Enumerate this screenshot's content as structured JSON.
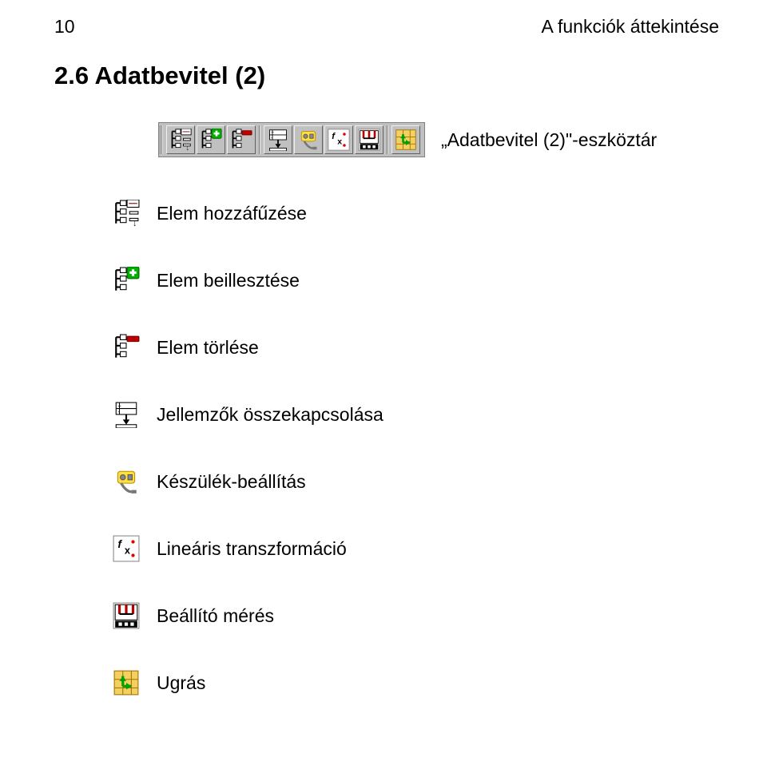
{
  "header": {
    "page_number": "10",
    "doc_title": "A funkciók áttekintése"
  },
  "section": {
    "heading": "2.6  Adatbevitel (2)"
  },
  "toolbar": {
    "caption": "„Adatbevitel (2)\"-eszköztár"
  },
  "icons": {
    "append": {
      "name": "tree-append-icon"
    },
    "insert": {
      "name": "tree-insert-icon"
    },
    "delete": {
      "name": "tree-delete-icon"
    },
    "link": {
      "name": "link-attributes-icon"
    },
    "device": {
      "name": "device-settings-icon"
    },
    "linear": {
      "name": "linear-transform-icon"
    },
    "measure": {
      "name": "tuning-measure-icon"
    },
    "jump": {
      "name": "jump-icon"
    }
  },
  "items": [
    {
      "key": "append",
      "label": "Elem hozzáfűzése"
    },
    {
      "key": "insert",
      "label": "Elem beillesztése"
    },
    {
      "key": "delete",
      "label": "Elem törlése"
    },
    {
      "key": "link",
      "label": "Jellemzők összekapcsolása"
    },
    {
      "key": "device",
      "label": "Készülék-beállítás"
    },
    {
      "key": "linear",
      "label": "Lineáris transzformáció"
    },
    {
      "key": "measure",
      "label": "Beállító mérés"
    },
    {
      "key": "jump",
      "label": "Ugrás"
    }
  ]
}
